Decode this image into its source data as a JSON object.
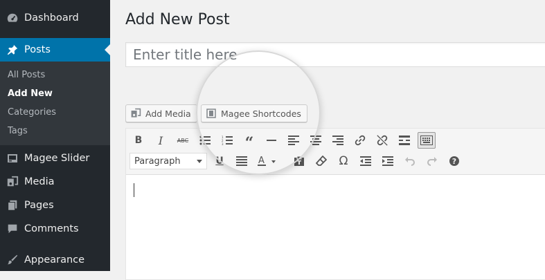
{
  "sidebar": {
    "items": [
      {
        "label": "Dashboard",
        "icon": "dashboard-icon"
      },
      {
        "label": "Posts",
        "icon": "pin-icon",
        "active": true
      },
      {
        "label": "Magee Slider",
        "icon": "slider-icon"
      },
      {
        "label": "Media",
        "icon": "media-icon"
      },
      {
        "label": "Pages",
        "icon": "pages-icon"
      },
      {
        "label": "Comments",
        "icon": "comments-icon"
      },
      {
        "label": "Appearance",
        "icon": "appearance-icon"
      }
    ],
    "submenu": [
      {
        "label": "All Posts"
      },
      {
        "label": "Add New",
        "current": true
      },
      {
        "label": "Categories"
      },
      {
        "label": "Tags"
      }
    ]
  },
  "main": {
    "page_title": "Add New Post",
    "title_placeholder": "Enter title here",
    "add_media_label": "Add Media",
    "shortcodes_label": "Magee Shortcodes"
  },
  "editor": {
    "format_select": "Paragraph",
    "toolbar_row1": [
      "bold-icon",
      "italic-icon",
      "strikethrough-icon",
      "bullet-list-icon",
      "numbered-list-icon",
      "blockquote-icon",
      "horizontal-line-icon",
      "align-left-icon",
      "align-center-icon",
      "align-right-icon",
      "link-icon",
      "unlink-icon",
      "read-more-icon",
      "toolbar-toggle-icon"
    ],
    "toolbar_row2": [
      "underline-icon",
      "justify-icon",
      "text-color-icon",
      "paste-text-icon",
      "clear-format-icon",
      "special-char-icon",
      "outdent-icon",
      "indent-icon",
      "undo-icon",
      "redo-icon",
      "help-icon"
    ]
  },
  "colors": {
    "sidebar_bg": "#23282d",
    "submenu_bg": "#32373c",
    "accent": "#0073aa"
  }
}
